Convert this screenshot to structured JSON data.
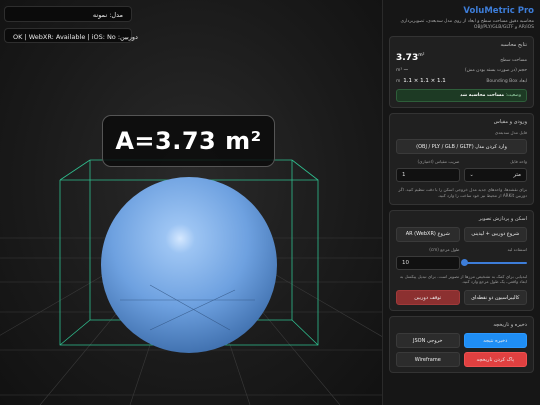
{
  "viewport": {
    "model_label": "مدل: نمونه",
    "status": "OK | WebXR: Available | iOS: No :دوربین",
    "area_overlay": "A=3.73 m²"
  },
  "panel": {
    "title": "VoluMetric Pro",
    "subtitle": "محاسبه دقیق مساحت سطح و ابعاد از روی مدل سه‌بعدی، تصویربرداری AR/iOS و OBJ/PLY/GLB/GLTF",
    "result": {
      "section_title": "نتایج محاسبه",
      "area_label": "مساحت سطح",
      "area_value": "3.73",
      "area_unit": "m²",
      "volume_label": "حجم (در صورت بسته بودن مش)",
      "volume_value": "—",
      "volume_unit": "m³",
      "bbox_label": "Bounding Box ابعاد",
      "bbox_value": "1.1 × 1.1 × 1.1",
      "bbox_unit": "m",
      "status_prefix": "وضعیت:",
      "status_value": "مساحت محاسبه شد"
    },
    "input": {
      "section_title": "ورودی و مقیاس",
      "file_label": "فایل مدل سه‌بعدی",
      "load_button": "وارد کردن مدل (OBJ / PLY / GLB / GLTF)",
      "unit_label": "واحد فایل",
      "unit_value": "متر",
      "scale_label": "ضریب مقیاس (اختیاری)",
      "scale_value": "1",
      "hint": "برای نقشه‌ها، واحدهای جدید مدل خروجی اسکن را با دقت تنظیم کنید. اگر دوربین ARKit از محیط نیز خود ساخت را وارد کنید."
    },
    "scan": {
      "section_title": "اسکن و پردازش تصویر",
      "ar_button": "شروع AR (WebXR)",
      "camera_button": "شروع دوربین + لیدینی",
      "step_label": "استفاده لبه",
      "resolution_label": "طول مرجع (cm)",
      "resolution_value": "10",
      "hint": "لبه‌یابی برای کمک به تشخیص مرزها از تصویر است. برای تبدیل پیکسل به ابعاد واقعی، یک طول مرجع وارد کنید.",
      "stop_button": "توقف دوربین",
      "calibrate_button": "کالیبراسیون دو نقطه‌ای"
    },
    "history": {
      "section_title": "ذخیره و تاریخچه",
      "save_button": "ذخیره نتیجه",
      "json_button": "خروجی JSON",
      "clear_button": "پاک کردن تاریخچه",
      "wireframe_button": "Wireframe"
    },
    "colors": {
      "accent": "#3d7dd8",
      "save": "#1f8ef5",
      "clear": "#e04040",
      "stop": "#8c3030",
      "status_bg": "#1d3a24"
    }
  }
}
